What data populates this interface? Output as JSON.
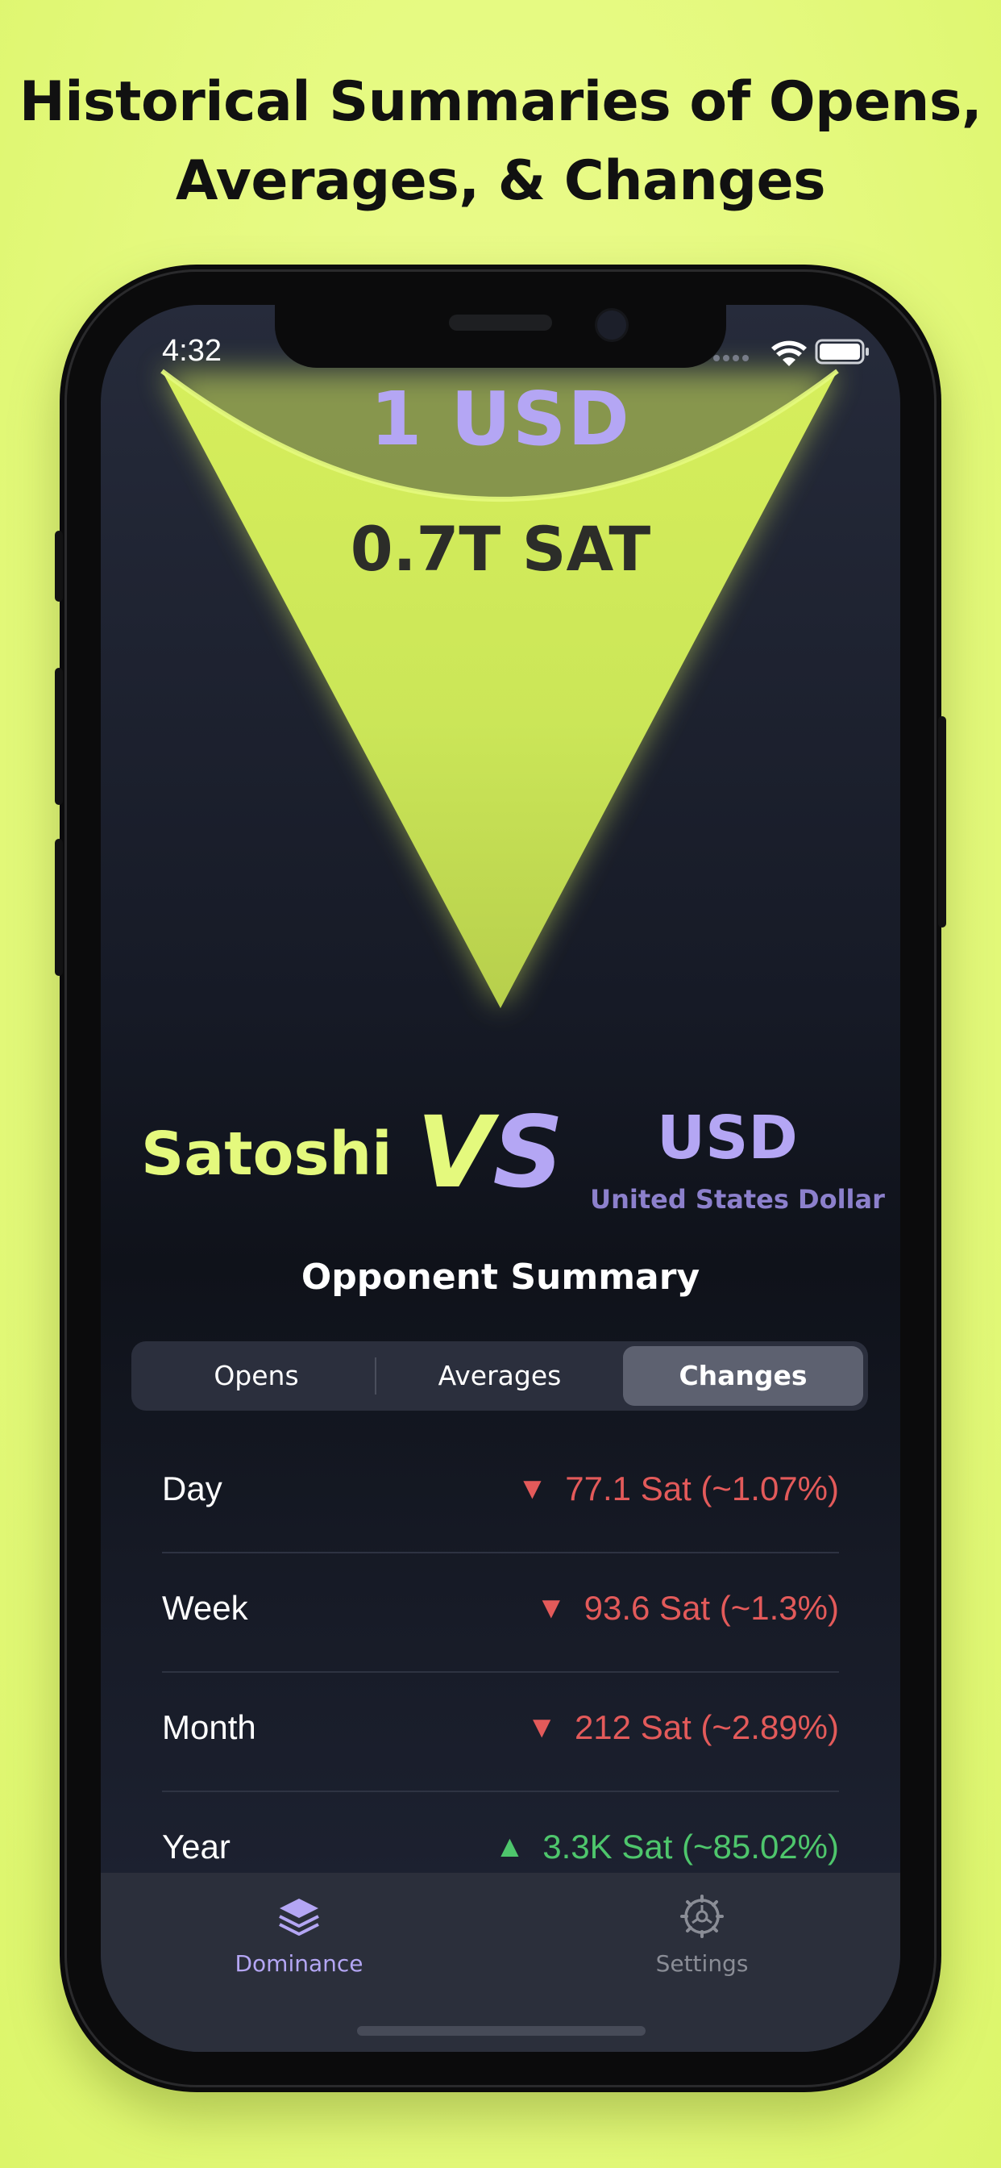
{
  "headline": {
    "line1": "Historical Summaries of Opens,",
    "line2": "Averages, & Changes"
  },
  "status_bar": {
    "time": "4:32"
  },
  "hero": {
    "base_amount": "1 USD",
    "converted_amount": "0.7T SAT"
  },
  "matchup": {
    "left_name": "Satoshi",
    "vs_v": "V",
    "vs_s": "S",
    "right_code": "USD",
    "right_name": "United States Dollar"
  },
  "summary": {
    "title": "Opponent Summary",
    "tabs": [
      "Opens",
      "Averages",
      "Changes"
    ],
    "active_tab": "Changes",
    "rows": [
      {
        "label": "Day",
        "direction": "down",
        "icon": "▼",
        "value": "77.1 Sat (~1.07%)"
      },
      {
        "label": "Week",
        "direction": "down",
        "icon": "▼",
        "value": "93.6 Sat (~1.3%)"
      },
      {
        "label": "Month",
        "direction": "down",
        "icon": "▼",
        "value": "212 Sat (~2.89%)"
      },
      {
        "label": "Year",
        "direction": "up",
        "icon": "▲",
        "value": "3.3K Sat (~85.02%)"
      }
    ]
  },
  "tabbar": {
    "items": [
      {
        "label": "Dominance",
        "icon": "stack-icon",
        "active": true
      },
      {
        "label": "Settings",
        "icon": "gear-icon",
        "active": false
      }
    ]
  },
  "colors": {
    "background": "#e4f97d",
    "accent_green": "#e4f97d",
    "accent_purple": "#b4a6f4",
    "down_red": "#e35a5a",
    "up_green": "#4ec66c"
  }
}
